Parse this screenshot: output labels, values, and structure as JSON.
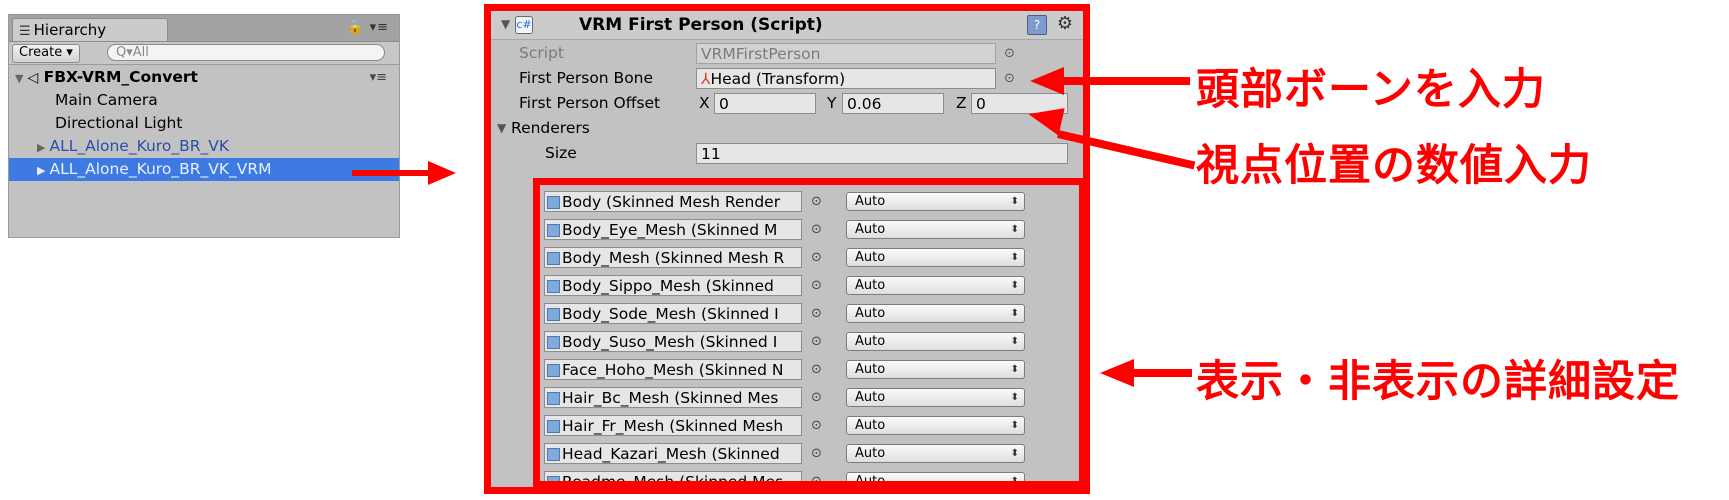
{
  "hierarchy": {
    "tab_label": "Hierarchy",
    "tab_icon": "☰",
    "lock_icon": "🔒 ▾≡",
    "create_label": "Create ▾",
    "search_placeholder": "Q▾All",
    "scene_name": "FBX-VRM_Convert",
    "scene_menu": "▾≡",
    "items": [
      {
        "label": "Main Camera"
      },
      {
        "label": "Directional Light"
      },
      {
        "label": "ALL_Alone_Kuro_BR_VK"
      },
      {
        "label": "ALL_Alone_Kuro_BR_VK_VRM"
      }
    ],
    "selected_item": "ALL_Alone_Kuro_BR_VK_VRM"
  },
  "inspector": {
    "component_title": "VRM First Person (Script)",
    "script_label": "Script",
    "script_value": "VRMFirstPerson",
    "bone_label": "First Person Bone",
    "bone_value": "Head (Transform)",
    "offset_label": "First Person Offset",
    "offset": {
      "x_label": "X",
      "x": "0",
      "y_label": "Y",
      "y": "0.06",
      "z_label": "Z",
      "z": "0"
    },
    "renderers_label": "Renderers",
    "size_label": "Size",
    "size_value": "11",
    "renderers": [
      {
        "name": "Body (Skinned Mesh Render",
        "mode": "Auto"
      },
      {
        "name": "Body_Eye_Mesh (Skinned M",
        "mode": "Auto"
      },
      {
        "name": "Body_Mesh (Skinned Mesh R",
        "mode": "Auto"
      },
      {
        "name": "Body_Sippo_Mesh (Skinned",
        "mode": "Auto"
      },
      {
        "name": "Body_Sode_Mesh (Skinned I",
        "mode": "Auto"
      },
      {
        "name": "Body_Suso_Mesh (Skinned I",
        "mode": "Auto"
      },
      {
        "name": "Face_Hoho_Mesh (Skinned N",
        "mode": "Auto"
      },
      {
        "name": "Hair_Bc_Mesh (Skinned Mes",
        "mode": "Auto"
      },
      {
        "name": "Hair_Fr_Mesh (Skinned Mesh",
        "mode": "Auto"
      },
      {
        "name": "Head_Kazari_Mesh (Skinned",
        "mode": "Auto"
      },
      {
        "name": "Readme_Mesh (Skinned Mes",
        "mode": "Auto"
      }
    ]
  },
  "annotations": {
    "head_bone": "頭部ボーンを入力",
    "viewpoint": "視点位置の数値入力",
    "display_settings": "表示・非表示の詳細設定"
  },
  "colors": {
    "highlight": "#ff0000",
    "selection": "#3d7be3",
    "prefab_text": "#2a4fa8",
    "panel_bg": "#c2c2c2"
  }
}
